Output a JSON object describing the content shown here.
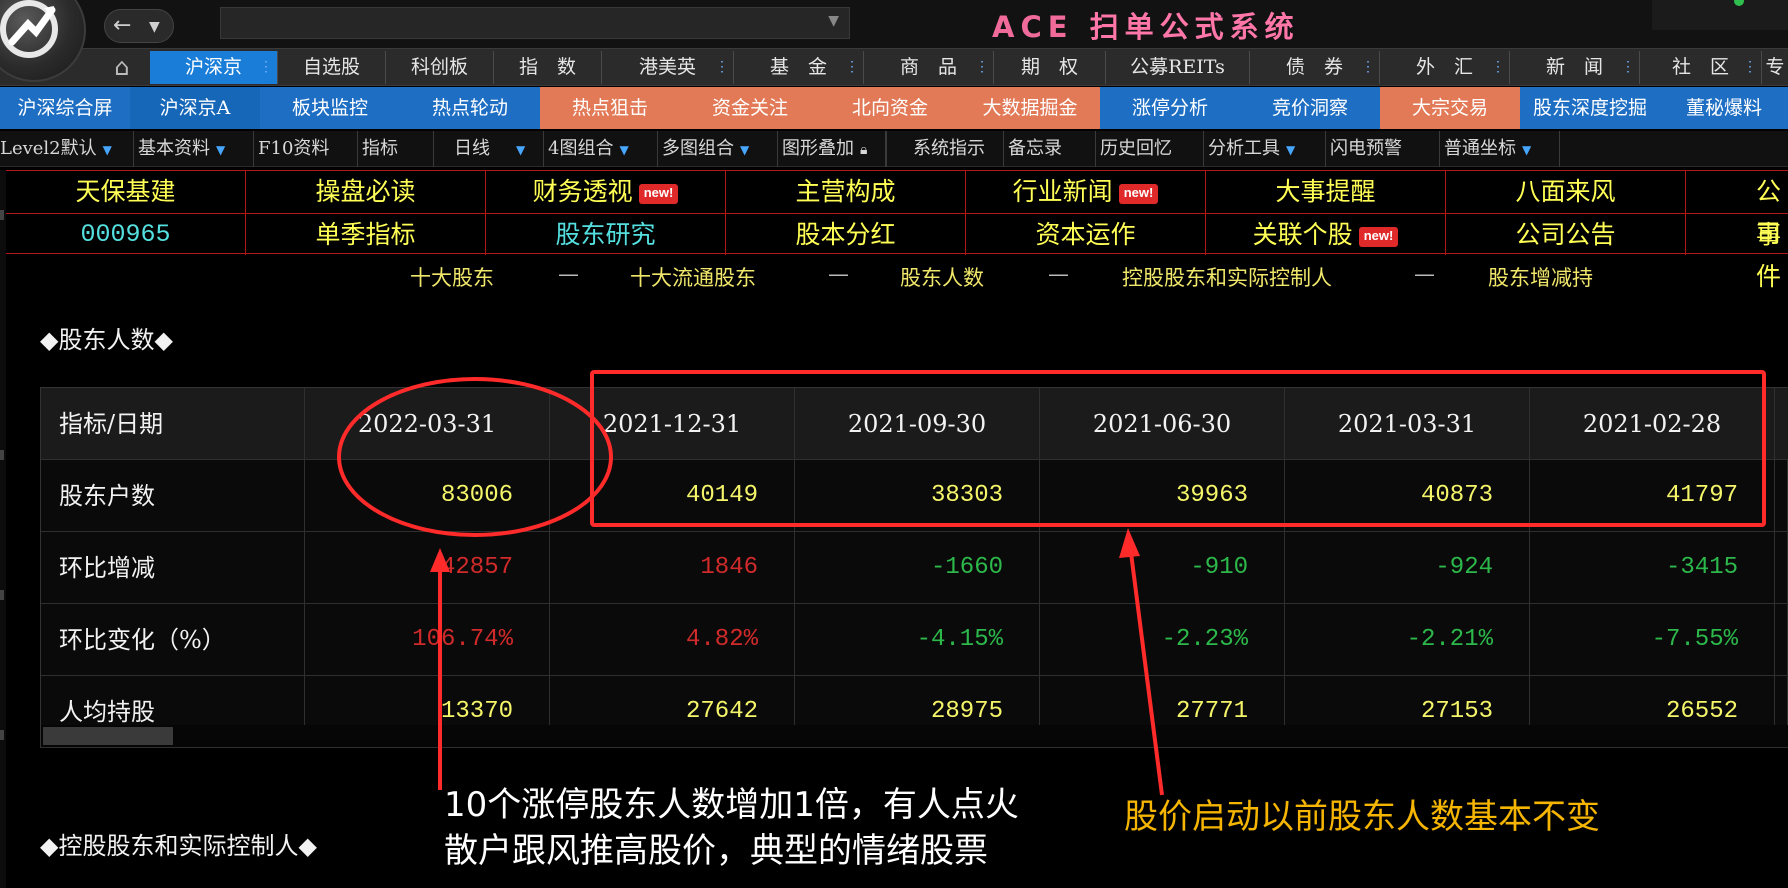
{
  "app": {
    "title_prefix": "ACE",
    "title_cn": "扫单公式系统"
  },
  "main_nav": [
    {
      "label": "沪深京",
      "active": true
    },
    {
      "label": "自选股"
    },
    {
      "label": "科创板"
    },
    {
      "label": "指　数"
    },
    {
      "label": "港美英"
    },
    {
      "label": "基　金"
    },
    {
      "label": "商　品"
    },
    {
      "label": "期　权"
    },
    {
      "label": "公募REITs"
    },
    {
      "label": "债　券"
    },
    {
      "label": "外　汇"
    },
    {
      "label": "新　闻"
    },
    {
      "label": "社　区"
    },
    {
      "label": "专"
    }
  ],
  "sub_nav": [
    {
      "label": "沪深综合屏"
    },
    {
      "label": "沪深京A"
    },
    {
      "label": "板块监控"
    },
    {
      "label": "热点轮动"
    },
    {
      "label": "热点狙击"
    },
    {
      "label": "资金关注"
    },
    {
      "label": "北向资金"
    },
    {
      "label": "大数据掘金"
    },
    {
      "label": "涨停分析"
    },
    {
      "label": "竞价洞察"
    },
    {
      "label": "大宗交易"
    },
    {
      "label": "股东深度挖掘"
    },
    {
      "label": "董秘爆料"
    }
  ],
  "toolbar": [
    {
      "label": "Level2默认"
    },
    {
      "label": "基本资料"
    },
    {
      "label": "F10资料"
    },
    {
      "label": "指标"
    },
    {
      "label": "日线"
    },
    {
      "label": "4图组合"
    },
    {
      "label": "多图组合"
    },
    {
      "label": "图形叠加"
    },
    {
      "label": "系统指示"
    },
    {
      "label": "备忘录"
    },
    {
      "label": "历史回忆"
    },
    {
      "label": "分析工具"
    },
    {
      "label": "闪电预警"
    },
    {
      "label": "普通坐标"
    }
  ],
  "stock": {
    "name": "天保基建",
    "code": "000965"
  },
  "f10_row1": [
    "操盘必读",
    "财务透视",
    "主营构成",
    "行业新闻",
    "大事提醒",
    "八面来风",
    "公司"
  ],
  "f10_row2": [
    "单季指标",
    "股东研究",
    "股本分红",
    "资本运作",
    "关联个股",
    "公司公告",
    "事件"
  ],
  "new_badge": "new!",
  "section_tabs": [
    "十大股东",
    "十大流通股东",
    "股东人数",
    "控股股东和实际控制人",
    "股东增减持"
  ],
  "section_sep": "—",
  "sections": {
    "holders_count": "◆股东人数◆",
    "controlling": "◆控股股东和实际控制人◆"
  },
  "table": {
    "header_label": "指标/日期",
    "dates": [
      "2022-03-31",
      "2021-12-31",
      "2021-09-30",
      "2021-06-30",
      "2021-03-31",
      "2021-02-28"
    ],
    "rows": [
      {
        "label": "股东户数",
        "values": [
          "83006",
          "40149",
          "38303",
          "39963",
          "40873",
          "41797"
        ],
        "colors": [
          "yellow",
          "yellow",
          "yellow",
          "yellow",
          "yellow",
          "yellow"
        ]
      },
      {
        "label": "环比增减",
        "values": [
          "42857",
          "1846",
          "-1660",
          "-910",
          "-924",
          "-3415"
        ],
        "colors": [
          "red",
          "red",
          "green",
          "green",
          "green",
          "green"
        ]
      },
      {
        "label": "环比变化（%）",
        "values": [
          "106.74%",
          "4.82%",
          "-4.15%",
          "-2.23%",
          "-2.21%",
          "-7.55%"
        ],
        "colors": [
          "red",
          "red",
          "green",
          "green",
          "green",
          "green"
        ]
      },
      {
        "label": "人均持股",
        "values": [
          "13370",
          "27642",
          "28975",
          "27771",
          "27153",
          "26552"
        ],
        "colors": [
          "yellow",
          "yellow",
          "yellow",
          "yellow",
          "yellow",
          "yellow"
        ]
      }
    ]
  },
  "annotations": {
    "left_line1": "10个涨停股东人数增加1倍，有人点火",
    "left_line2": "散户跟风推高股价，典型的情绪股票",
    "right": "股价启动以前股东人数基本不变"
  },
  "colors": {
    "active_nav": "#1a7ed8",
    "sub_blue": "#1e6fc4",
    "sub_orange": "#e27a57",
    "stock_yellow": "#ffff55",
    "grid_red": "#b01818",
    "annotation_red": "#ff2a2a",
    "annotation_orange": "#f5b500"
  }
}
